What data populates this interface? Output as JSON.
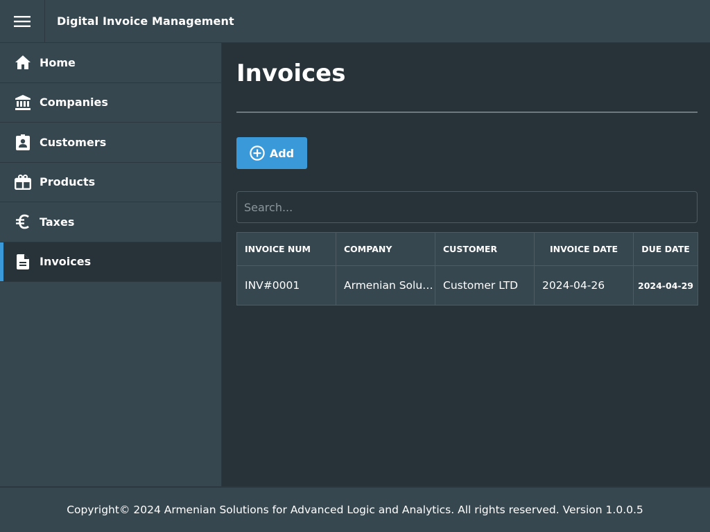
{
  "header": {
    "title": "Digital Invoice Management",
    "menu_icon": "hamburger-menu-icon"
  },
  "sidebar": {
    "items": [
      {
        "label": "Home",
        "icon": "home-icon",
        "active": false
      },
      {
        "label": "Companies",
        "icon": "bank-icon",
        "active": false
      },
      {
        "label": "Customers",
        "icon": "contact-badge-icon",
        "active": false
      },
      {
        "label": "Products",
        "icon": "gift-box-icon",
        "active": false
      },
      {
        "label": "Taxes",
        "icon": "euro-icon",
        "active": false
      },
      {
        "label": "Invoices",
        "icon": "document-icon",
        "active": true
      }
    ]
  },
  "main": {
    "page_title": "Invoices",
    "add_button": {
      "label": "Add",
      "icon": "plus-circle-icon"
    },
    "search": {
      "placeholder": "Search...",
      "value": ""
    },
    "table": {
      "columns": [
        "INVOICE NUM",
        "COMPANY",
        "CUSTOMER",
        "INVOICE DATE",
        "DUE DATE"
      ],
      "rows": [
        [
          "INV#0001",
          "Armenian Solutions for Advanced Logic and Analytics",
          "Customer LTD",
          "2024-04-26",
          "2024-04-29"
        ]
      ]
    }
  },
  "footer": {
    "text": "Copyright© 2024 Armenian Solutions for Advanced Logic and Analytics. All rights reserved. Version 1.0.0.5"
  },
  "colors": {
    "accent": "#3a9ad9",
    "panel": "#37474f",
    "background": "#283339"
  }
}
